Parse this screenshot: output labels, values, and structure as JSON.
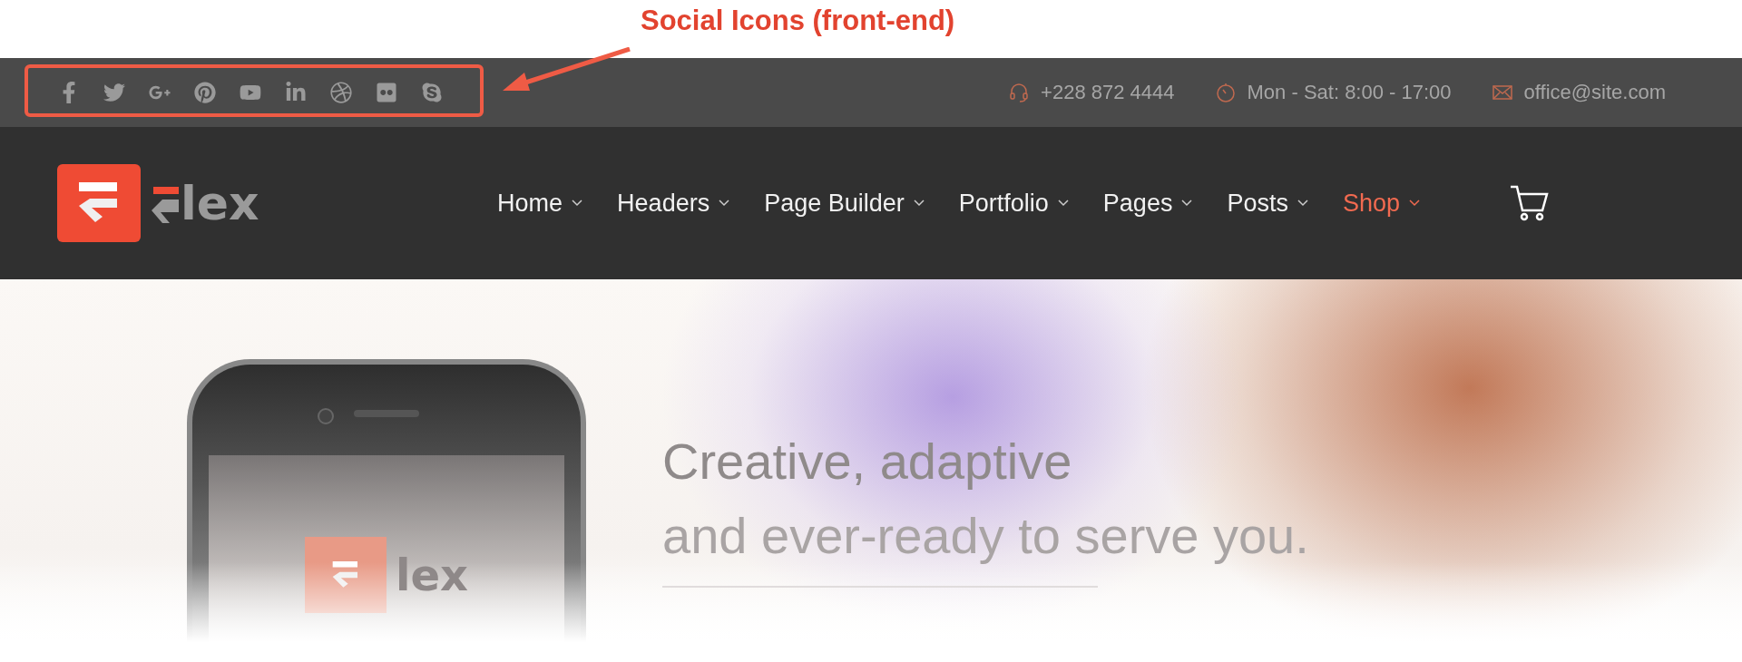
{
  "annotation": {
    "label": "Social Icons (front-end)"
  },
  "top_bar": {
    "contacts": [
      {
        "kind": "phone",
        "text": "+228 872 4444"
      },
      {
        "kind": "hours",
        "text": "Mon - Sat: 8:00 - 17:00"
      },
      {
        "kind": "email",
        "text": "office@site.com"
      }
    ]
  },
  "header": {
    "logo_text": "lex",
    "menu": [
      {
        "label": "Home",
        "selected": false
      },
      {
        "label": "Headers",
        "selected": false
      },
      {
        "label": "Page Builder",
        "selected": false
      },
      {
        "label": "Portfolio",
        "selected": false
      },
      {
        "label": "Pages",
        "selected": false
      },
      {
        "label": "Posts",
        "selected": false
      },
      {
        "label": "Shop",
        "selected": true
      }
    ]
  },
  "hero": {
    "phone_logo_text": "lex",
    "headline": [
      "Creative, adaptive",
      "and ever-ready to serve you."
    ]
  }
}
